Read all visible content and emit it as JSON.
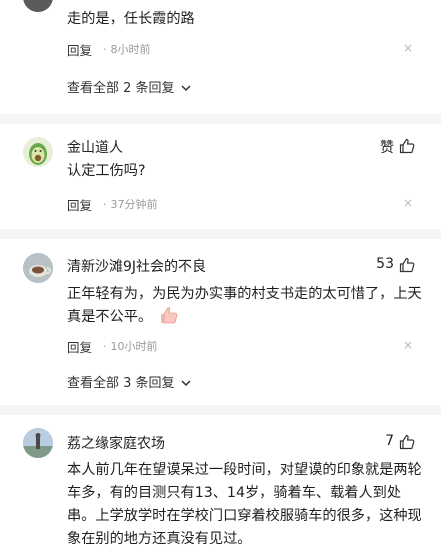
{
  "comment0": {
    "content": "走的是，任长霞的路",
    "reply_label": "回复",
    "time": "8小时前",
    "close_symbol": "×",
    "view_more": "查看全部 2 条回复"
  },
  "comment1": {
    "name": "金山道人",
    "like_label": "赞",
    "content": "认定工伤吗?",
    "reply_label": "回复",
    "time": "37分钟前",
    "close_symbol": "×"
  },
  "comment2": {
    "name": "清新沙滩9J社会的不良",
    "likes": "53",
    "content": "正年轻有为，为民为办实事的村支书走的太可惜了，上天真是不公平。",
    "reply_label": "回复",
    "time": "10小时前",
    "close_symbol": "×",
    "view_more": "查看全部 3 条回复"
  },
  "comment3": {
    "name": "荔之缘家庭农场",
    "likes": "7",
    "content": "本人前几年在望谟呆过一段时间，对望谟的印象就是两轮车多，有的目测只有13、14岁，骑着车、载着人到处串。上学放学时在学校门口穿着校服骑车的很多，这种现象在别的地方还真没有见过。"
  },
  "icons": {
    "like": "thumbs-up-outline",
    "chevron": "chevron-down",
    "emoji": "thumbs-up-emoji"
  }
}
